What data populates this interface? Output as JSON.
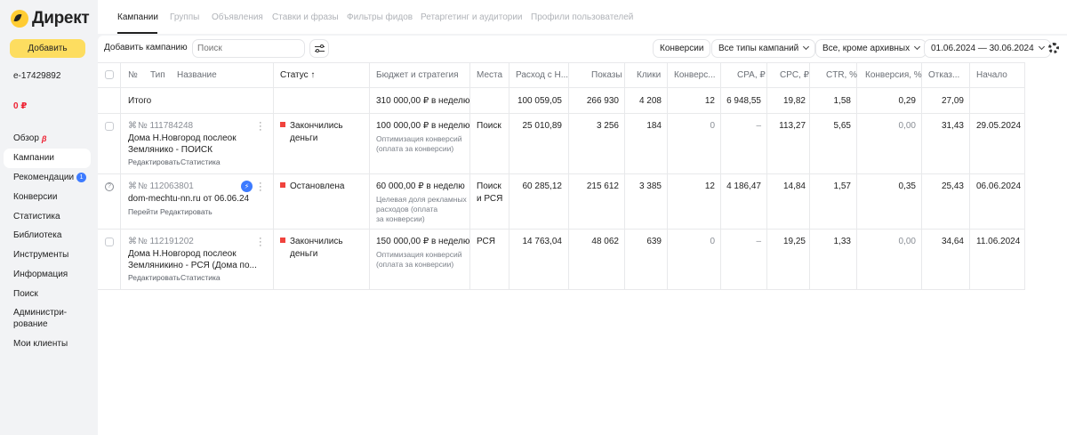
{
  "app": {
    "logo_text": "Директ",
    "add_label": "Добавить"
  },
  "account": {
    "login": "e-17429892",
    "balance": "0 ₽"
  },
  "nav": {
    "items": [
      {
        "label": "Обзор",
        "beta": "β"
      },
      {
        "label": "Кампании"
      },
      {
        "label": "Рекомендации",
        "badge": "1"
      },
      {
        "label": "Конверсии"
      },
      {
        "label": "Статистика"
      },
      {
        "label": "Библиотека"
      },
      {
        "label": "Инструменты"
      },
      {
        "label": "Информация"
      },
      {
        "label": "Поиск"
      },
      {
        "label": "Администри-\nрование"
      },
      {
        "label": "Мои клиенты"
      }
    ]
  },
  "tabs": [
    "Кампании",
    "Группы",
    "Объявления",
    "Ставки и фразы",
    "Фильтры фидов",
    "Ретаргетинг и аудитории",
    "Профили пользователей"
  ],
  "toolbar": {
    "add_campaign": "Добавить кампанию",
    "search_placeholder": "Поиск",
    "conversions": "Конверсии",
    "campaign_types": "Все типы кампаний",
    "archive_filter": "Все, кроме архивных",
    "date_range": "01.06.2024 — 30.06.2024"
  },
  "table": {
    "headers": {
      "num": "№",
      "type": "Тип",
      "name": "Название",
      "status": "Статус ↑",
      "budget": "Бюджет и стратегия",
      "places": "Места",
      "spend": "Расход с Н...",
      "impressions": "Показы",
      "clicks": "Клики",
      "conv": "Конверс...",
      "cpa": "CPA, ₽",
      "cpc": "CPC, ₽",
      "ctr": "CTR, %",
      "conv_rate": "Конверсия, %",
      "bounce": "Отказ...",
      "start": "Начало"
    },
    "total": {
      "label": "Итого",
      "budget": "310 000,00 ₽ в неделю",
      "spend": "100 059,05",
      "impressions": "266 930",
      "clicks": "4 208",
      "conv": "12",
      "cpa": "6 948,55",
      "cpc": "19,82",
      "ctr": "1,58",
      "conv_rate": "0,29",
      "bounce": "27,09"
    },
    "rows": [
      {
        "id": "№ 111784248",
        "name1": "Дома Н.Новгород послеок",
        "name2": "Землянико - ПОИСК",
        "link1": "Редактировать",
        "link2": "Статистика",
        "status1": "Закончились",
        "status2": "деньги",
        "budget": "100 000,00 ₽ в неделю",
        "strategy1": "Оптимизация конверсий",
        "strategy2": "(оплата за конверсии)",
        "strategy3": "",
        "places1": "Поиск",
        "places2": "",
        "spend": "25 010,89",
        "impressions": "3 256",
        "clicks": "184",
        "conv": "0",
        "cpa": "–",
        "cpc": "113,27",
        "ctr": "5,65",
        "conv_rate": "0,00",
        "bounce": "31,43",
        "start": "29.05.2024"
      },
      {
        "id": "№ 112063801",
        "name1": "dom-mechtu-nn.ru от 06.06.24",
        "name2": "",
        "link1": "Перейти",
        "link2": "Редактировать",
        "status1": "Остановлена",
        "status2": "",
        "budget": "60 000,00 ₽ в неделю",
        "strategy1": "Целевая доля рекламных",
        "strategy2": "расходов (оплата",
        "strategy3": "за конверсии)",
        "places1": "Поиск",
        "places2": "и РСЯ",
        "spend": "60 285,12",
        "impressions": "215 612",
        "clicks": "3 385",
        "conv": "12",
        "cpa": "4 186,47",
        "cpc": "14,84",
        "ctr": "1,57",
        "conv_rate": "0,35",
        "bounce": "25,43",
        "start": "06.06.2024"
      },
      {
        "id": "№ 112191202",
        "name1": "Дома Н.Новгород послеок",
        "name2": "Земляникино - РСЯ (Дома по...",
        "link1": "Редактировать",
        "link2": "Статистика",
        "status1": "Закончились",
        "status2": "деньги",
        "budget": "150 000,00 ₽ в неделю",
        "strategy1": "Оптимизация конверсий",
        "strategy2": "(оплата за конверсии)",
        "strategy3": "",
        "places1": "РСЯ",
        "places2": "",
        "spend": "14 763,04",
        "impressions": "48 062",
        "clicks": "639",
        "conv": "0",
        "cpa": "–",
        "cpc": "19,25",
        "ctr": "1,33",
        "conv_rate": "0,00",
        "bounce": "34,64",
        "start": "11.06.2024"
      }
    ]
  }
}
